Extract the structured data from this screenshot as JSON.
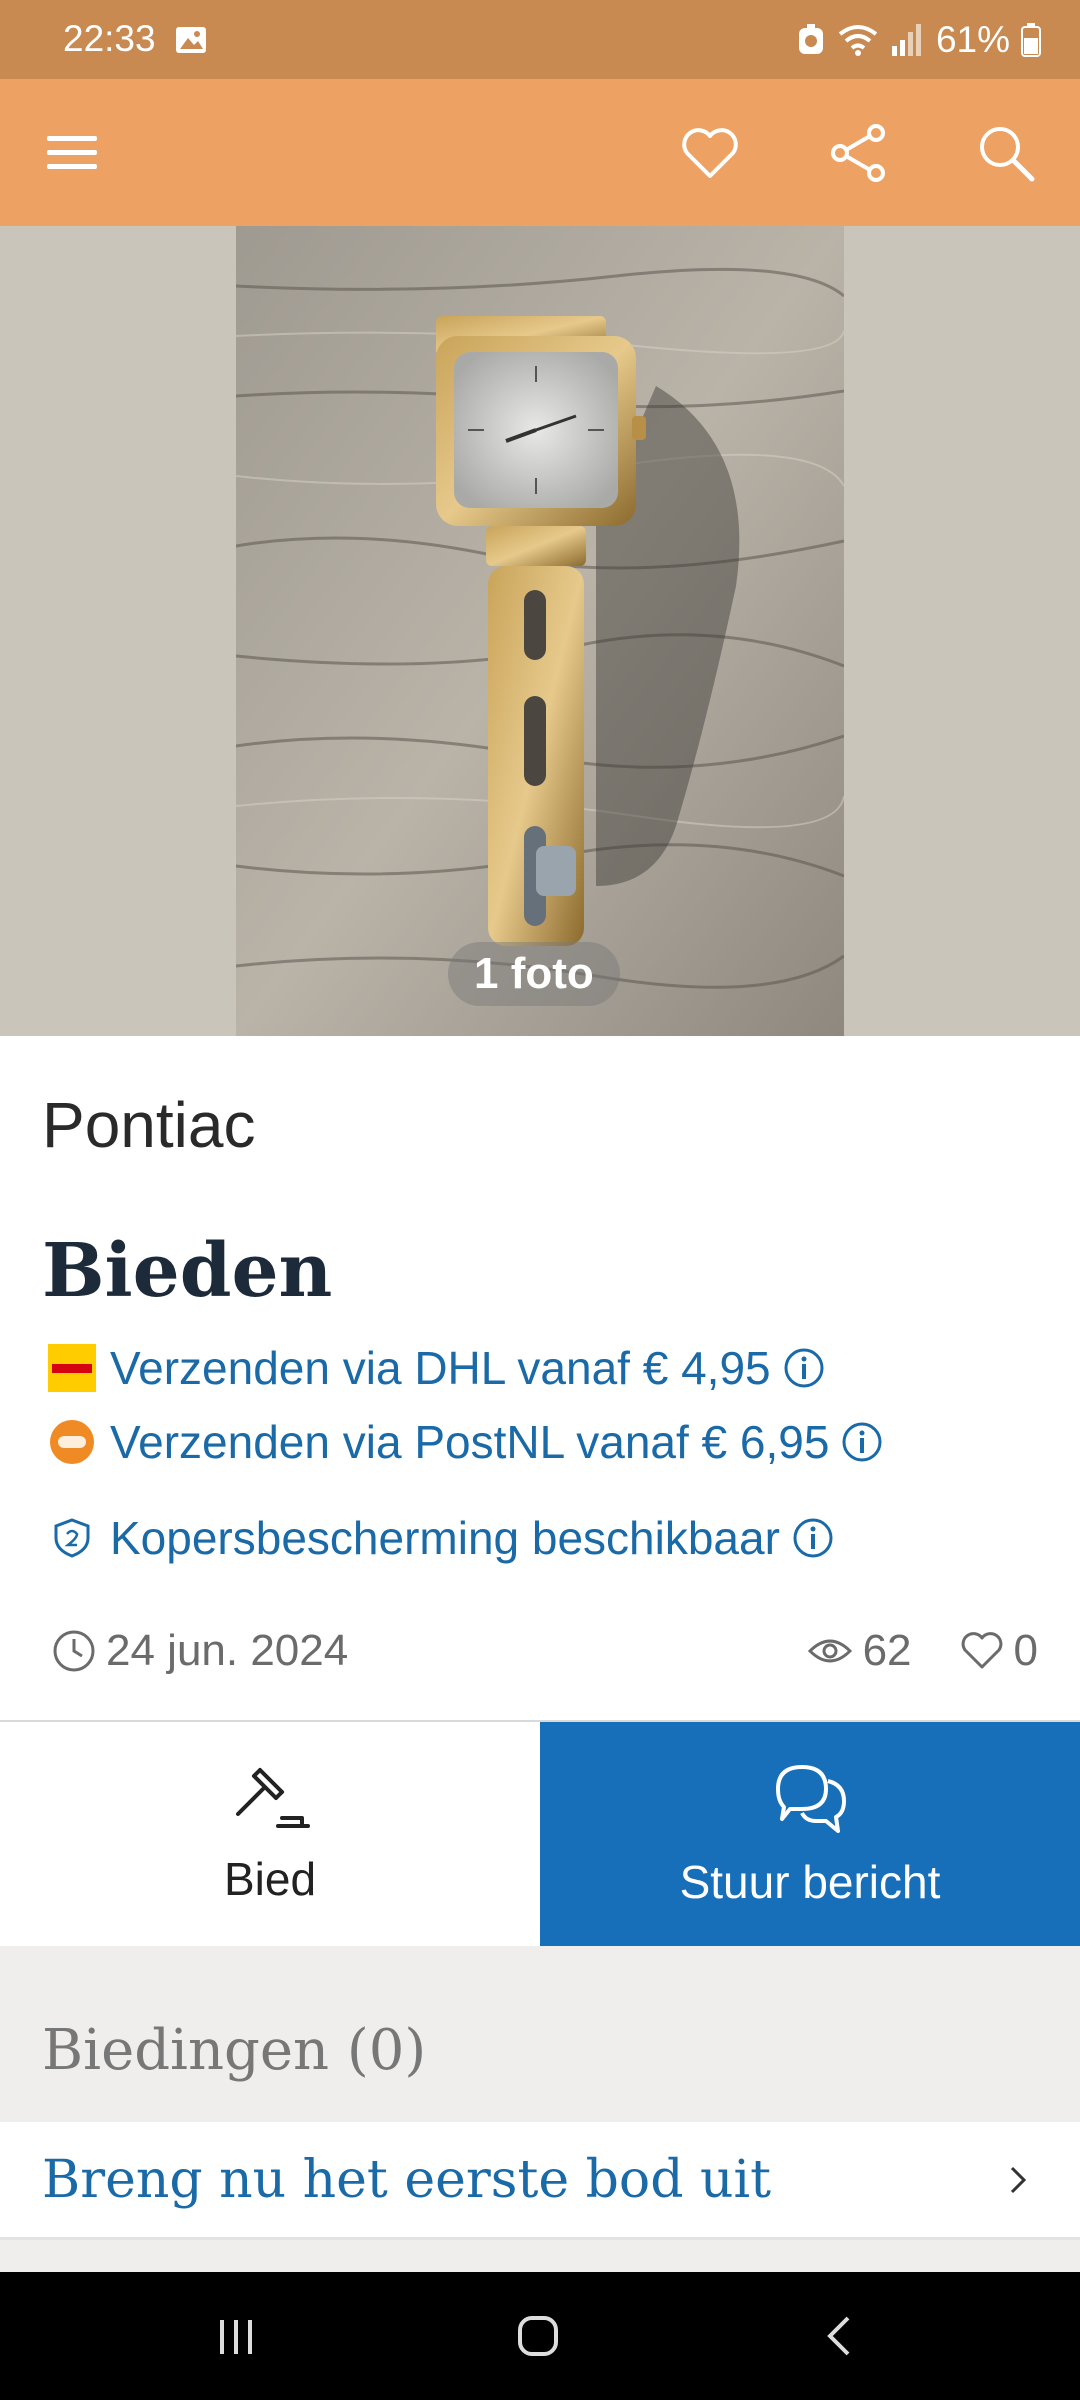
{
  "status_bar": {
    "time": "22:33",
    "battery": "61%",
    "icons": [
      "image-icon",
      "data-saver-icon",
      "wifi-icon",
      "signal-icon",
      "battery-icon"
    ]
  },
  "app_bar": {
    "icons": [
      "menu-icon",
      "heart-icon",
      "share-icon",
      "search-icon"
    ],
    "background": "#eda162"
  },
  "photo": {
    "count_label": "1 foto"
  },
  "listing": {
    "title": "Pontiac",
    "price": "Bieden",
    "shipping": [
      {
        "text": "Verzenden via DHL vanaf € 4,95",
        "logo": "dhl-logo"
      },
      {
        "text": "Verzenden via PostNL vanaf € 6,95",
        "logo": "postnl-logo"
      }
    ],
    "protection": "Kopersbescherming beschikbaar",
    "date": "24 jun. 2024",
    "views": "62",
    "favorites": "0"
  },
  "actions": {
    "bid_label": "Bied",
    "message_label": "Stuur bericht",
    "accent": "#176fb9"
  },
  "bids": {
    "heading": "Biedingen (0)",
    "first_bid": "Breng nu het eerste bod uit"
  },
  "nav_bar": {
    "icons": [
      "recent-apps-icon",
      "home-icon",
      "back-icon"
    ]
  }
}
